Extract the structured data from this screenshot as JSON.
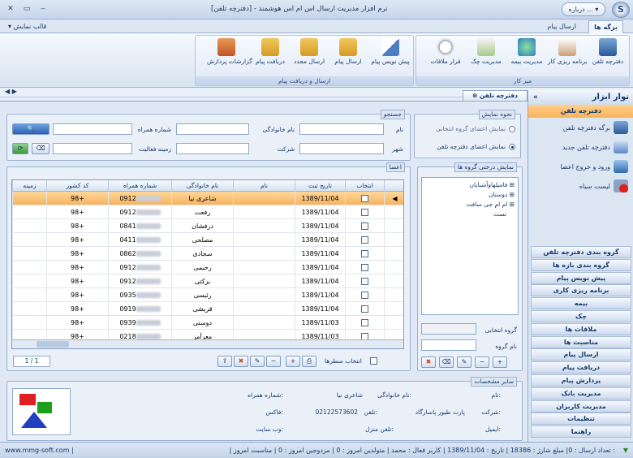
{
  "window": {
    "title": "[نرم افزار مدیریت ارسال اس ام اس هوشمند - [دفترچه تلفن",
    "about": "درباره ...",
    "logo_letter": "S"
  },
  "tabs": [
    "برگه ها",
    "ارسال پیام"
  ],
  "view_template": "قالب نمایش",
  "ribbon": {
    "desk_group": "میز کار",
    "desk_buttons": [
      "دفترچه تلفن",
      "برنامه ریزی کار",
      "مدیریت بیمه",
      "مدیریت چک",
      "قرار ملاقات"
    ],
    "msg_group": "ارسال و دریافت پیام",
    "msg_buttons": [
      "پیش نویس پیام",
      "ارسال پیام",
      "ارسال مجدد",
      "دریافت پیام",
      "گزارشات پردازش"
    ]
  },
  "doc_tab": "دفترچه تلفن",
  "display_mode": {
    "title": "نحوه نمایش",
    "option1": "نمایش اعضای گروه انتخابی",
    "option2": "نمایش اعضای دفترچه تلفن"
  },
  "search": {
    "title": "جستجو",
    "name": "نام",
    "family": "نام خانوادگی",
    "mobile": "شماره همراه",
    "city": "شهر",
    "company": "شرکت",
    "activity": "زمینه فعالیت"
  },
  "members": {
    "title": "اعضا",
    "headers": [
      "انتخاب",
      "تاریخ ثبت",
      "نام",
      "نام خانوادگی",
      "شماره همراه",
      "کد کشور",
      "زمینه"
    ],
    "rows": [
      {
        "date": "1389/11/04",
        "name": "",
        "family": "شاعری نیا",
        "mobile": "0912",
        "code": "98+"
      },
      {
        "date": "1389/11/04",
        "name": "",
        "family": "رفعت",
        "mobile": "0912",
        "code": "98+"
      },
      {
        "date": "1389/11/04",
        "name": "",
        "family": "درفشان",
        "mobile": "0841",
        "code": "98+"
      },
      {
        "date": "1389/11/04",
        "name": "",
        "family": "مصلحی",
        "mobile": "0411",
        "code": "98+"
      },
      {
        "date": "1389/11/04",
        "name": "",
        "family": "سجادی",
        "mobile": "0862",
        "code": "98+"
      },
      {
        "date": "1389/11/04",
        "name": "",
        "family": "رحیمی",
        "mobile": "0912",
        "code": "98+"
      },
      {
        "date": "1389/11/04",
        "name": "",
        "family": "برکتی",
        "mobile": "0912",
        "code": "98+"
      },
      {
        "date": "1389/11/04",
        "name": "",
        "family": "رئیسی",
        "mobile": "0935",
        "code": "98+"
      },
      {
        "date": "1389/11/04",
        "name": "",
        "family": "قریشی",
        "mobile": "0919",
        "code": "98+"
      },
      {
        "date": "1389/11/03",
        "name": "",
        "family": "دوستی",
        "mobile": "0939",
        "code": "98+"
      },
      {
        "date": "1389/11/03",
        "name": "",
        "family": "معرآمز",
        "mobile": "0218",
        "code": "98+"
      }
    ],
    "pager": "1 / 1",
    "select_rows": "انتخاب سطرها"
  },
  "tree": {
    "title": "نمایش درختی گروه ها",
    "items": [
      "فامیلهاوآشنایان",
      "دوستان",
      "ام ام جی سافت",
      "تست"
    ],
    "selected_group": "گروه انتخابی",
    "group_name": "نام گروه"
  },
  "details": {
    "title": "سایر مشخصات",
    "name_lbl": "نام:",
    "family_lbl": "نام خانوادگی:",
    "family_val": "شاعری نیا",
    "mobile_lbl": "شماره همراه:",
    "company_lbl": "شرکت:",
    "company_val": "پارت طیور پاسارگاد",
    "phone_lbl": "تلفن:",
    "phone_val": "02122573602",
    "fax_lbl": "فاکس:",
    "email_lbl": "ایمیل:",
    "home_lbl": "تلفن منزل:",
    "web_lbl": "وب سایت:"
  },
  "sidebar": {
    "title": "نوار ابزار",
    "selected": "دفترچه تلفن",
    "items": [
      "برگه دفترچه تلفن",
      "دفترچه تلفن جدید",
      "ورود و خروج اعضا",
      "لیست سیاه"
    ],
    "nav": [
      "گروه بندی دفترچه تلفن",
      "گروه بندی بازه ها",
      "پیش نویس پیام",
      "برنامه ریزی کاری",
      "بیمه",
      "چک",
      "ملاقات ها",
      "مناسبت ها",
      "ارسال پیام",
      "دریافت پیام",
      "پردازش پیام",
      "مدیریت بانک",
      "مدیریت کاربران",
      "تنظیمات",
      "راهنما"
    ]
  },
  "status": {
    "left": "www.mmg-soft.com |",
    "right": "| تعداد ارسال : 0| مبلغ شارژ : 18386 | تاریخ : 1389/11/04 | کاربر فعال : محمد | متولدین امروز : 0 | مزدوجین امروز : 0 | مناسبت امروز :"
  }
}
